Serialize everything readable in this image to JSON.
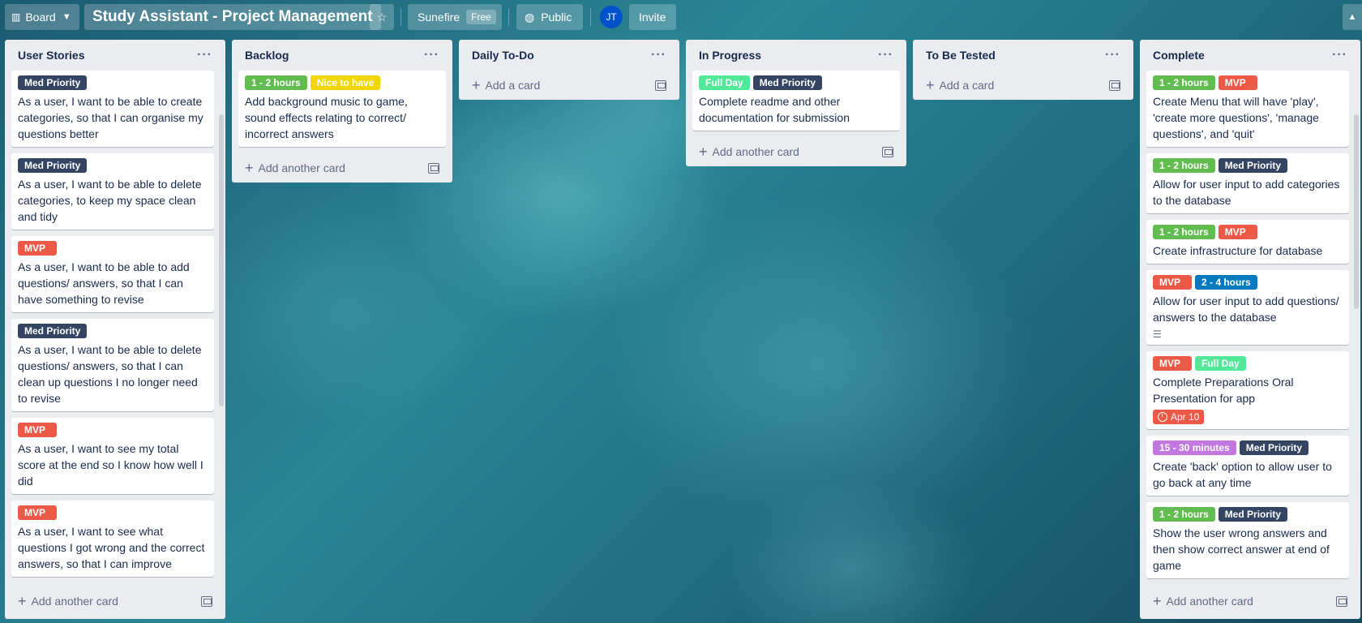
{
  "topbar": {
    "board_btn": "Board",
    "board_title": "Study Assistant - Project Management",
    "workspace": "Sunefire",
    "workspace_badge": "Free",
    "visibility": "Public",
    "avatar": "JT",
    "invite": "Invite"
  },
  "colors": {
    "green": "#61bd4f",
    "yellow": "#f2d600",
    "red": "#eb5a46",
    "navy": "#344563",
    "lime": "#51e898",
    "blue": "#0079bf",
    "purple": "#c377e0"
  },
  "lists": [
    {
      "title": "User Stories",
      "add_label": "Add another card",
      "cards": [
        {
          "labels": [
            {
              "text": "Med Priority",
              "color": "navy"
            }
          ],
          "text": "As a user, I want to be able to create categories, so that I can organise my questions better"
        },
        {
          "labels": [
            {
              "text": "Med Priority",
              "color": "navy"
            }
          ],
          "text": "As a user, I want to be able to delete categories, to keep my space clean and tidy"
        },
        {
          "labels": [
            {
              "text": "MVP",
              "color": "red"
            }
          ],
          "text": "As a user, I want to be able to add questions/ answers, so that I can have something to revise"
        },
        {
          "labels": [
            {
              "text": "Med Priority",
              "color": "navy"
            }
          ],
          "text": "As a user, I want to be able to delete questions/ answers, so that I can clean up questions I no longer need to revise"
        },
        {
          "labels": [
            {
              "text": "MVP",
              "color": "red"
            }
          ],
          "text": "As a user, I want to see my total score at the end so I know how well I did"
        },
        {
          "labels": [
            {
              "text": "MVP",
              "color": "red"
            }
          ],
          "text": "As a user, I want to see what questions I got wrong and the correct answers, so that I can improve"
        }
      ]
    },
    {
      "title": "Backlog",
      "add_label": "Add another card",
      "cards": [
        {
          "labels": [
            {
              "text": "1 - 2 hours",
              "color": "green"
            },
            {
              "text": "Nice to have",
              "color": "yellow"
            }
          ],
          "text": "Add background music to game, sound effects relating to correct/ incorrect answers"
        }
      ]
    },
    {
      "title": "Daily To-Do",
      "add_label": "Add a card",
      "cards": []
    },
    {
      "title": "In Progress",
      "add_label": "Add another card",
      "cards": [
        {
          "labels": [
            {
              "text": "Full Day",
              "color": "lime"
            },
            {
              "text": "Med Priority",
              "color": "navy"
            }
          ],
          "text": "Complete readme and other documentation for submission"
        }
      ]
    },
    {
      "title": "To Be Tested",
      "add_label": "Add a card",
      "cards": []
    },
    {
      "title": "Complete",
      "add_label": "Add another card",
      "cards": [
        {
          "labels": [
            {
              "text": "1 - 2 hours",
              "color": "green"
            },
            {
              "text": "MVP",
              "color": "red"
            }
          ],
          "text": "Create Menu that will have 'play', 'create more questions', 'manage questions', and 'quit'"
        },
        {
          "labels": [
            {
              "text": "1 - 2 hours",
              "color": "green"
            },
            {
              "text": "Med Priority",
              "color": "navy"
            }
          ],
          "text": "Allow for user input to add categories to the database"
        },
        {
          "labels": [
            {
              "text": "1 - 2 hours",
              "color": "green"
            },
            {
              "text": "MVP",
              "color": "red"
            }
          ],
          "text": "Create infrastructure for database"
        },
        {
          "labels": [
            {
              "text": "MVP",
              "color": "red"
            },
            {
              "text": "2 - 4 hours",
              "color": "blue"
            }
          ],
          "text": "Allow for user input to add questions/ answers to the database",
          "has_description": true
        },
        {
          "labels": [
            {
              "text": "MVP",
              "color": "red"
            },
            {
              "text": "Full Day",
              "color": "lime"
            }
          ],
          "text": "Complete Preparations Oral Presentation for app",
          "due": "Apr 10"
        },
        {
          "labels": [
            {
              "text": "15 - 30 minutes",
              "color": "purple"
            },
            {
              "text": "Med Priority",
              "color": "navy"
            }
          ],
          "text": "Create 'back' option to allow user to go back at any time"
        },
        {
          "labels": [
            {
              "text": "1 - 2 hours",
              "color": "green"
            },
            {
              "text": "Med Priority",
              "color": "navy"
            }
          ],
          "text": "Show the user wrong answers and then show correct answer at end of game"
        }
      ]
    }
  ]
}
